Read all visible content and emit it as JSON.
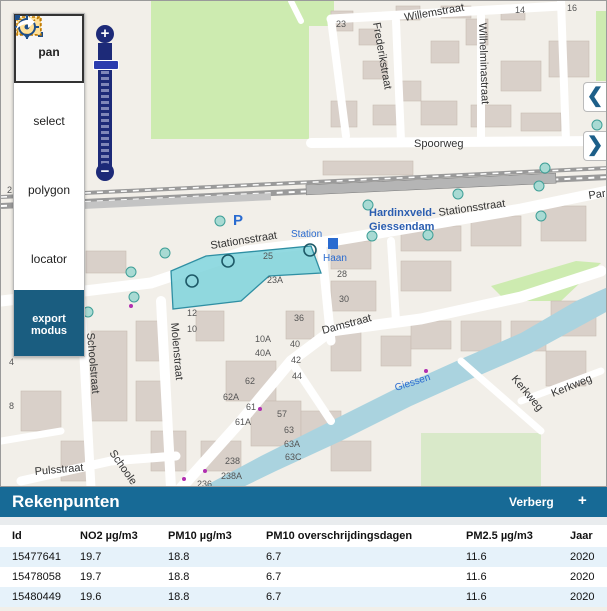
{
  "map": {
    "streets": [
      "Willemstraat",
      "Frederikstraat",
      "Wilhelminastraat",
      "Spoorweg",
      "Stationsstraat",
      "Stationsstraat",
      "Damstraat",
      "Molenstraat",
      "Schoolstraat",
      "Pulsstraat",
      "Kerkweg",
      "Kerkweg",
      "Giessen",
      "Paral",
      "Schoole",
      "onsstraat"
    ],
    "places": [
      "Hardinxveld-",
      "Giessendam"
    ],
    "pois": [
      "Station",
      "Haan",
      "P"
    ],
    "house_numbers": [
      "23",
      "16",
      "14",
      "2",
      "25",
      "23A",
      "30",
      "28",
      "12",
      "10",
      "10A",
      "36",
      "40A",
      "40",
      "42",
      "44",
      "62",
      "62A",
      "57",
      "61",
      "63",
      "61A",
      "63A",
      "63C",
      "238",
      "238A",
      "236",
      "4",
      "8"
    ]
  },
  "toolbar": {
    "tools": [
      {
        "label": "pan",
        "icon": "pan-arrows-icon",
        "active": true
      },
      {
        "label": "select",
        "icon": "select-rectangle-icon",
        "active": false
      },
      {
        "label": "polygon",
        "icon": "polygon-icon",
        "active": false
      },
      {
        "label": "locator",
        "icon": "crosshair-icon",
        "active": false
      }
    ],
    "export_line1": "export",
    "export_line2": "modus"
  },
  "zoom": {
    "plus": "+",
    "minus": "−"
  },
  "side": {
    "left_arrow": "❮",
    "right_arrow": "❯"
  },
  "panel": {
    "title": "Rekenpunten",
    "hide": "Verberg",
    "add": "+",
    "columns": [
      "Id",
      "NO2 µg/m3",
      "PM10 µg/m3",
      "PM10 overschrijdingsdagen",
      "PM2.5 µg/m3",
      "Jaar"
    ],
    "rows": [
      [
        "15477641",
        "19.7",
        "18.8",
        "6.7",
        "11.6",
        "2020"
      ],
      [
        "15478058",
        "19.7",
        "18.8",
        "6.7",
        "11.6",
        "2020"
      ],
      [
        "15480449",
        "19.6",
        "18.8",
        "6.7",
        "11.6",
        "2020"
      ]
    ]
  },
  "colors": {
    "selection_fill": "#7fd3dc",
    "selection_stroke": "#2f8fa3",
    "header_blue": "#176a96",
    "water": "#a9d3df",
    "rail": "#8f8f8f"
  }
}
